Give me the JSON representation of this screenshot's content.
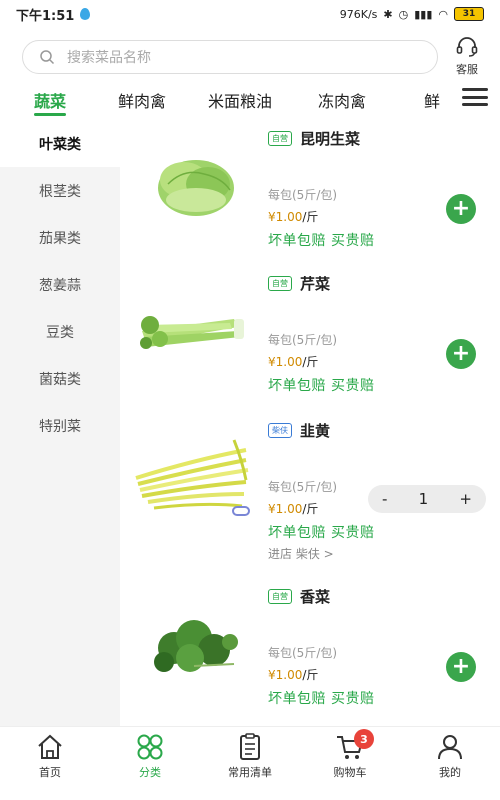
{
  "status": {
    "time": "下午1:51",
    "net_speed": "976K/s",
    "battery": "31"
  },
  "search": {
    "placeholder": "搜索菜品名称",
    "service_label": "客服"
  },
  "category_tabs": [
    {
      "label": "蔬菜",
      "active": true
    },
    {
      "label": "鲜肉禽",
      "active": false
    },
    {
      "label": "米面粮油",
      "active": false
    },
    {
      "label": "冻肉禽",
      "active": false
    },
    {
      "label": "鲜",
      "active": false
    }
  ],
  "sidebar": {
    "items": [
      {
        "label": "叶菜类",
        "active": true
      },
      {
        "label": "根茎类",
        "active": false
      },
      {
        "label": "茄果类",
        "active": false
      },
      {
        "label": "葱姜蒜",
        "active": false
      },
      {
        "label": "豆类",
        "active": false
      },
      {
        "label": "菌菇类",
        "active": false
      },
      {
        "label": "特别菜",
        "active": false
      }
    ]
  },
  "products": [
    {
      "badge": "自营",
      "name": "昆明生菜",
      "unit": "每包(5斤/包)",
      "price_symbol": "¥",
      "price": "1.00",
      "price_unit": "/斤",
      "guarantee": "坏单包赔 买贵赔",
      "quantity": 0
    },
    {
      "badge": "自营",
      "name": "芹菜",
      "unit": "每包(5斤/包)",
      "price_symbol": "¥",
      "price": "1.00",
      "price_unit": "/斤",
      "guarantee": "坏单包赔 买贵赔",
      "quantity": 0
    },
    {
      "badge": "柴伕",
      "name": "韭黄",
      "unit": "每包(5斤/包)",
      "price_symbol": "¥",
      "price": "1.00",
      "price_unit": "/斤",
      "guarantee": "坏单包赔 买贵赔",
      "quantity": "1",
      "store_link": "进店 柴伕 >"
    },
    {
      "badge": "自营",
      "name": "香菜",
      "unit": "每包(5斤/包)",
      "price_symbol": "¥",
      "price": "1.00",
      "price_unit": "/斤",
      "guarantee": "坏单包赔 买贵赔",
      "quantity": 0
    }
  ],
  "stepper": {
    "minus": "-",
    "plus": "+"
  },
  "bottom_nav": [
    {
      "label": "首页",
      "icon": "home-icon",
      "active": false
    },
    {
      "label": "分类",
      "icon": "category-icon",
      "active": true
    },
    {
      "label": "常用清单",
      "icon": "list-icon",
      "active": false
    },
    {
      "label": "购物车",
      "icon": "cart-icon",
      "active": false,
      "badge": "3"
    },
    {
      "label": "我的",
      "icon": "profile-icon",
      "active": false
    }
  ],
  "colors": {
    "accent": "#2aa84a",
    "badge": "#e8433a"
  }
}
